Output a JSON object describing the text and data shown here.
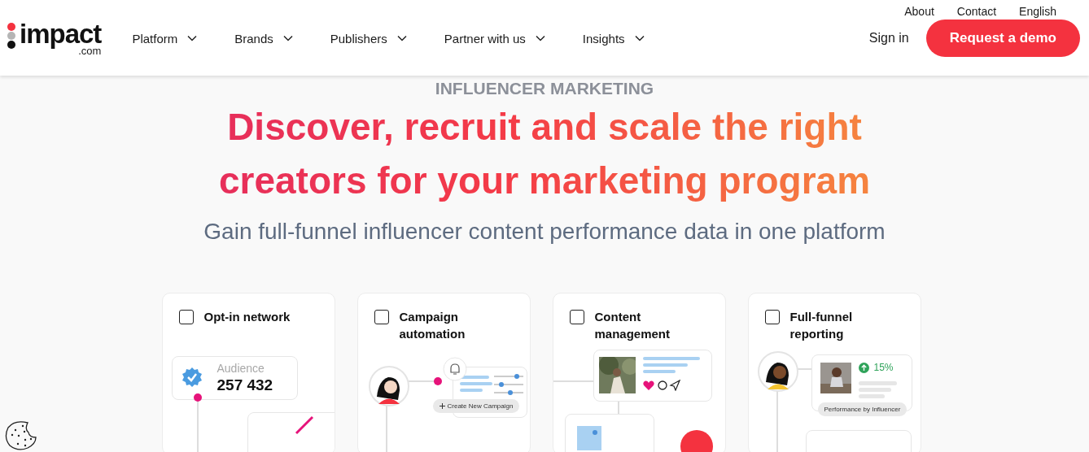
{
  "header": {
    "logo": {
      "name": "impact",
      "suffix": ".com"
    },
    "utility_links": [
      "About",
      "Contact",
      "English"
    ],
    "nav": [
      {
        "label": "Platform"
      },
      {
        "label": "Brands"
      },
      {
        "label": "Publishers"
      },
      {
        "label": "Partner with us"
      },
      {
        "label": "Insights"
      }
    ],
    "sign_in": "Sign in",
    "cta": "Request a demo"
  },
  "hero": {
    "eyebrow": "INFLUENCER MARKETING",
    "headline": "Discover, recruit and scale the right creators for your marketing program",
    "subtitle": "Gain full-funnel influencer content performance data in one platform"
  },
  "features": [
    {
      "kind": "audience",
      "title": "Opt-in network",
      "checked": false,
      "label": "Audience",
      "value": "257 432"
    },
    {
      "kind": "campaign",
      "title": "Campaign automation",
      "checked": false,
      "chip": "Create New Campaign"
    },
    {
      "kind": "content",
      "title": "Content management",
      "checked": false
    },
    {
      "kind": "reporting",
      "title": "Full-funnel reporting",
      "checked": false,
      "value": "15%",
      "chip": "Performance by Influencer"
    }
  ]
}
